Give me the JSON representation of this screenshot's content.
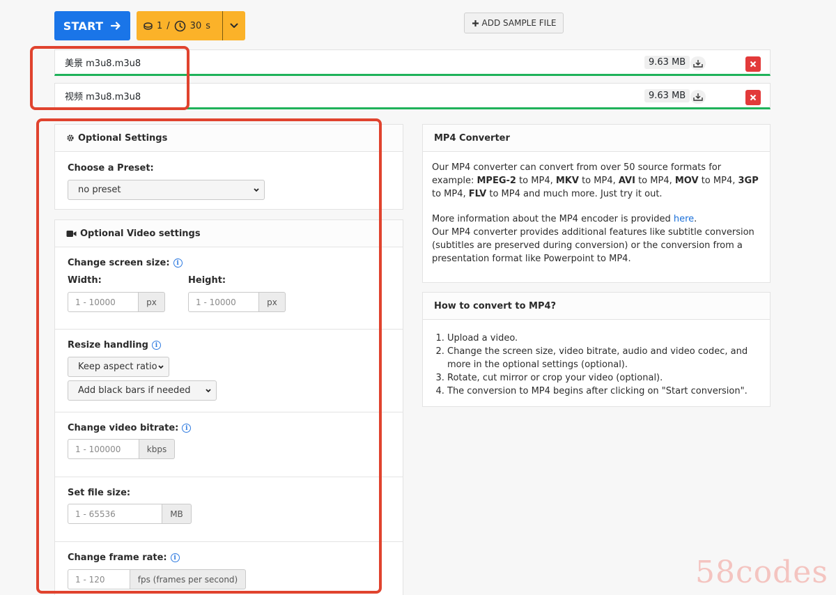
{
  "toolbar": {
    "start_label": "START",
    "credits_count": "1",
    "credits_separator": "/",
    "credits_time": "30",
    "credits_unit": "s",
    "sample_label": "ADD SAMPLE FILE"
  },
  "files": [
    {
      "name": "美景 m3u8.m3u8",
      "size": "9.63 MB"
    },
    {
      "name": "视频 m3u8.m3u8",
      "size": "9.63 MB"
    }
  ],
  "optional_settings": {
    "title": "Optional Settings",
    "preset_label": "Choose a Preset:",
    "preset_value": "no preset"
  },
  "video_settings": {
    "title": "Optional Video settings",
    "screen_size_label": "Change screen size:",
    "width_label": "Width:",
    "height_label": "Height:",
    "width_placeholder": "1 - 10000",
    "height_placeholder": "1 - 10000",
    "px_unit": "px",
    "resize_label": "Resize handling",
    "resize_value": "Keep aspect ratio",
    "bars_value": "Add black bars if needed",
    "bitrate_label": "Change video bitrate:",
    "bitrate_placeholder": "1 - 100000",
    "bitrate_unit": "kbps",
    "filesize_label": "Set file size:",
    "filesize_placeholder": "1 - 65536",
    "filesize_unit": "MB",
    "framerate_label": "Change frame rate:",
    "framerate_placeholder": "1 - 120",
    "framerate_unit": "fps (frames per second)"
  },
  "mp4_converter": {
    "title": "MP4 Converter",
    "p1_intro": "Our MP4 converter can convert from over 50 source formats for example:",
    "f1": "MPEG-2",
    "t1": " to MP4, ",
    "f2": "MKV",
    "t2": " to MP4, ",
    "f3": "AVI",
    "t3": " to MP4, ",
    "f4": "MOV",
    "t4": " to MP4, ",
    "f5": "3GP",
    "t5": " to MP4, ",
    "f6": "FLV",
    "t6": " to MP4 and much more. Just try it out.",
    "p2_prefix": "More information about the MP4 encoder is provided ",
    "p2_link": "here",
    "p2_suffix": ".",
    "p3": "Our MP4 converter provides additional features like subtitle conversion (subtitles are preserved during conversion) or the conversion from a presentation format like Powerpoint to MP4."
  },
  "howto": {
    "title": "How to convert to MP4?",
    "steps": [
      "Upload a video.",
      "Change the screen size, video bitrate, audio and video codec, and more in the optional settings (optional).",
      "Rotate, cut mirror or crop your video (optional).",
      "The conversion to MP4 begins after clicking on \"Start conversion\"."
    ]
  },
  "watermark": "58codes",
  "colors": {
    "start": "#1a75e8",
    "credits": "#fbb229",
    "progress": "#1fb25a",
    "delete": "#e23a3a",
    "highlight": "#e0432e"
  }
}
